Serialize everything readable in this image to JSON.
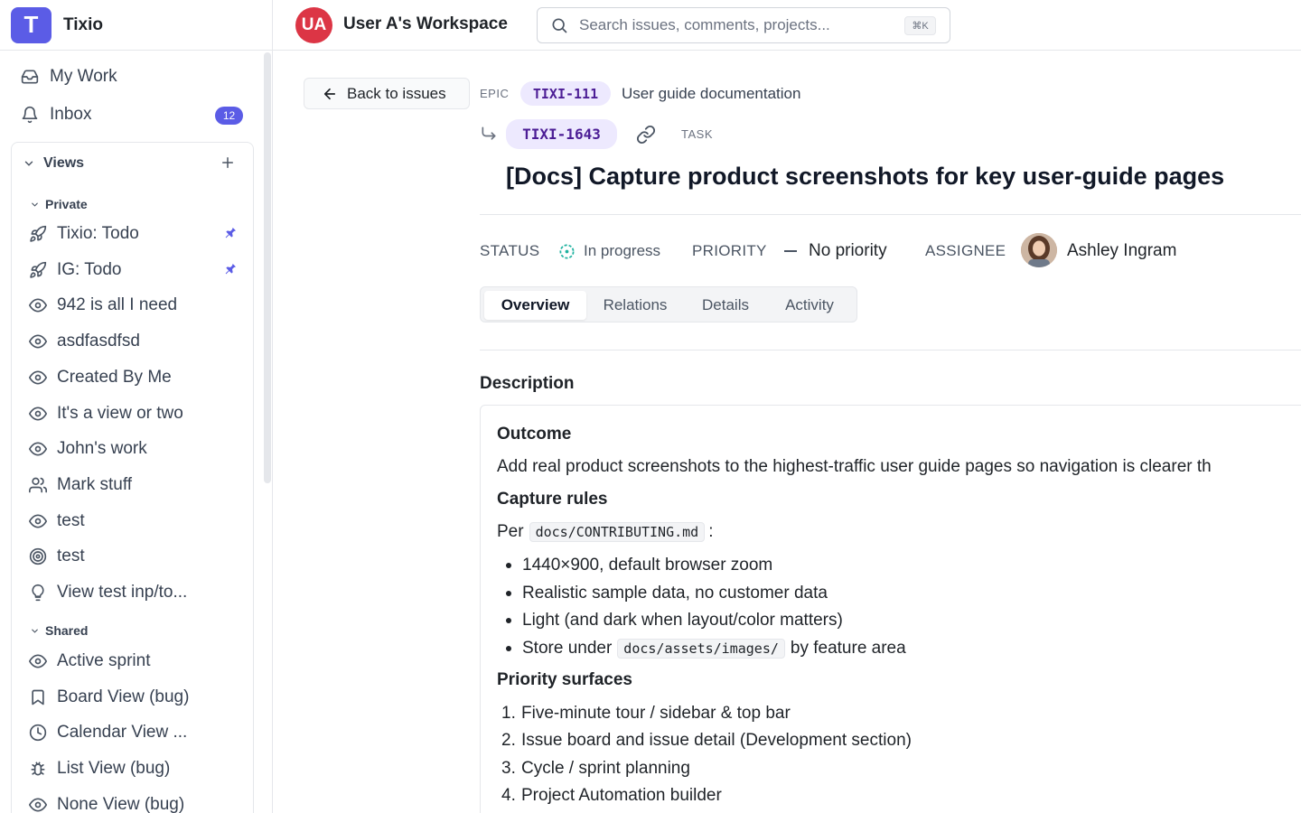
{
  "brand": {
    "logo_letter": "T",
    "name": "Tixio",
    "color": "#5b5ce6"
  },
  "sidebar": {
    "my_work": "My Work",
    "inbox": "Inbox",
    "inbox_count": "12",
    "views_label": "Views",
    "private_label": "Private",
    "shared_label": "Shared",
    "private_views": [
      {
        "label": "Tixio: Todo",
        "icon": "rocket-icon",
        "pinned": true
      },
      {
        "label": "IG: Todo",
        "icon": "rocket-icon",
        "pinned": true
      },
      {
        "label": "942 is all I need",
        "icon": "eye-icon"
      },
      {
        "label": "asdfasdfsd",
        "icon": "eye-icon"
      },
      {
        "label": "Created By Me",
        "icon": "eye-icon"
      },
      {
        "label": "It's a view or two",
        "icon": "eye-icon"
      },
      {
        "label": "John's work",
        "icon": "eye-icon"
      },
      {
        "label": "Mark stuff",
        "icon": "users-icon"
      },
      {
        "label": "test",
        "icon": "eye-icon"
      },
      {
        "label": "test",
        "icon": "target-icon"
      },
      {
        "label": "View test inp/to...",
        "icon": "lightbulb-icon"
      }
    ],
    "shared_views": [
      {
        "label": "Active sprint",
        "icon": "eye-icon"
      },
      {
        "label": "Board View (bug)",
        "icon": "bookmark-icon"
      },
      {
        "label": "Calendar View ...",
        "icon": "clock-icon"
      },
      {
        "label": "List View (bug)",
        "icon": "bug-icon"
      },
      {
        "label": "None View (bug)",
        "icon": "eye-icon"
      }
    ]
  },
  "topbar": {
    "workspace_initials": "UA",
    "workspace_name": "User A's Workspace",
    "search_placeholder": "Search issues, comments, projects...",
    "shortcut": "⌘K"
  },
  "issue": {
    "back_label": "Back to issues",
    "epic_label": "EPIC",
    "epic_id": "TIXI-111",
    "epic_title": "User guide documentation",
    "id": "TIXI-1643",
    "type_label": "TASK",
    "title": "[Docs] Capture product screenshots for key user-guide pages",
    "status_label": "STATUS",
    "status_value": "In progress",
    "priority_label": "PRIORITY",
    "priority_value": "No priority",
    "assignee_label": "ASSIGNEE",
    "assignee_name": "Ashley Ingram"
  },
  "tabs": [
    "Overview",
    "Relations",
    "Details",
    "Activity"
  ],
  "description": {
    "heading": "Description",
    "outcome_heading": "Outcome",
    "outcome_text": "Add real product screenshots to the highest-traffic user guide pages so navigation is clearer th",
    "rules_heading": "Capture rules",
    "per_prefix": "Per",
    "per_code": "docs/CONTRIBUTING.md",
    "per_suffix": ":",
    "rules": [
      "1440×900, default browser zoom",
      "Realistic sample data, no customer data",
      "Light (and dark when layout/color matters)"
    ],
    "store_prefix": "Store under",
    "store_code": "docs/assets/images/",
    "store_suffix": "by feature area",
    "surfaces_heading": "Priority surfaces",
    "surfaces": [
      "Five-minute tour / sidebar & top bar",
      "Issue board and issue detail (Development section)",
      "Cycle / sprint planning",
      "Project Automation builder"
    ]
  }
}
